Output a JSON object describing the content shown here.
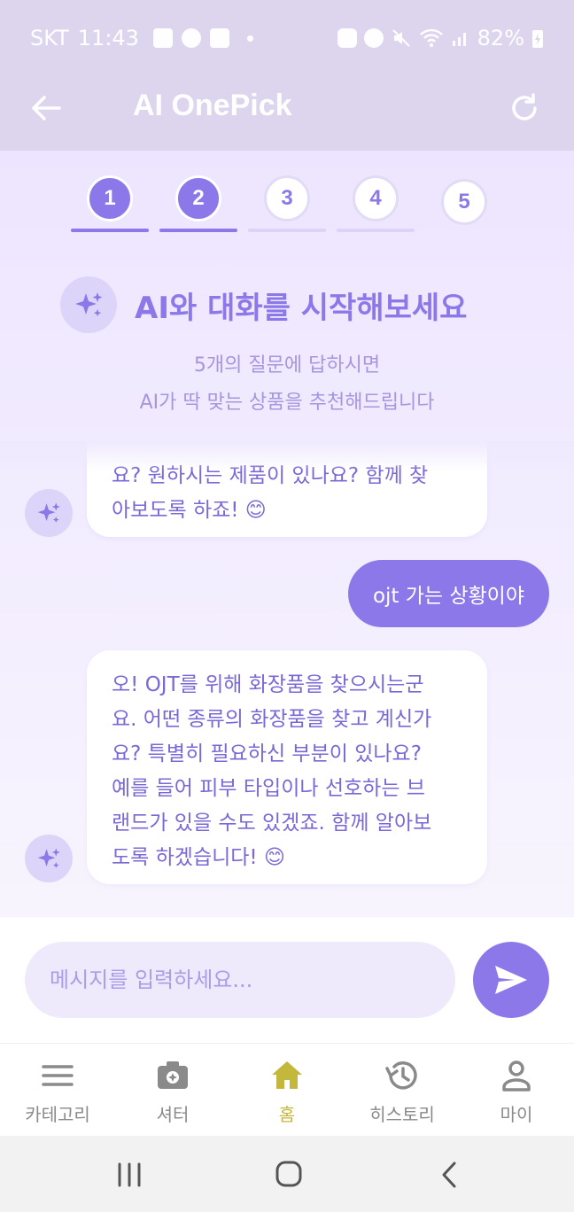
{
  "status_bar": {
    "carrier": "SKT",
    "time": "11:43",
    "battery": "82%"
  },
  "app_bar": {
    "title": "AI OnePick"
  },
  "steps": [
    {
      "label": "1",
      "state": "done"
    },
    {
      "label": "2",
      "state": "done"
    },
    {
      "label": "3",
      "state": "todo"
    },
    {
      "label": "4",
      "state": "todo"
    },
    {
      "label": "5",
      "state": "plain"
    }
  ],
  "hero": {
    "title": "AI와 대화를 시작해보세요",
    "subtitle_line1": "5개의 질문에 답하시면",
    "subtitle_line2": "AI가 딱 맞는 상품을 추천해드립니다"
  },
  "messages": [
    {
      "role": "ai",
      "lines": [
        "요? 원하시는 제품이 있나요? 함께 찾",
        "아보도록 하죠! 😊"
      ]
    },
    {
      "role": "user",
      "text": "ojt 가는 상황이야"
    },
    {
      "role": "ai",
      "lines": [
        "오! OJT를 위해 화장품을 찾으시는군",
        "요. 어떤 종류의 화장품을 찾고 계신가",
        "요? 특별히 필요하신 부분이 있나요?",
        "예를 들어 피부 타입이나 선호하는 브",
        "랜드가 있을 수도 있겠죠. 함께 알아보",
        "도록 하겠습니다! 😊"
      ]
    }
  ],
  "input": {
    "placeholder": "메시지를 입력하세요..."
  },
  "bottom_nav": [
    {
      "label": "카테고리",
      "icon": "menu-icon",
      "active": false
    },
    {
      "label": "셔터",
      "icon": "camera-icon",
      "active": false
    },
    {
      "label": "홈",
      "icon": "home-icon",
      "active": true
    },
    {
      "label": "히스토리",
      "icon": "history-icon",
      "active": false
    },
    {
      "label": "마이",
      "icon": "person-icon",
      "active": false
    }
  ],
  "colors": {
    "accent": "#8c78e8",
    "active_nav": "#c3b73c",
    "app_bar_bg": "#ddd5ee"
  }
}
